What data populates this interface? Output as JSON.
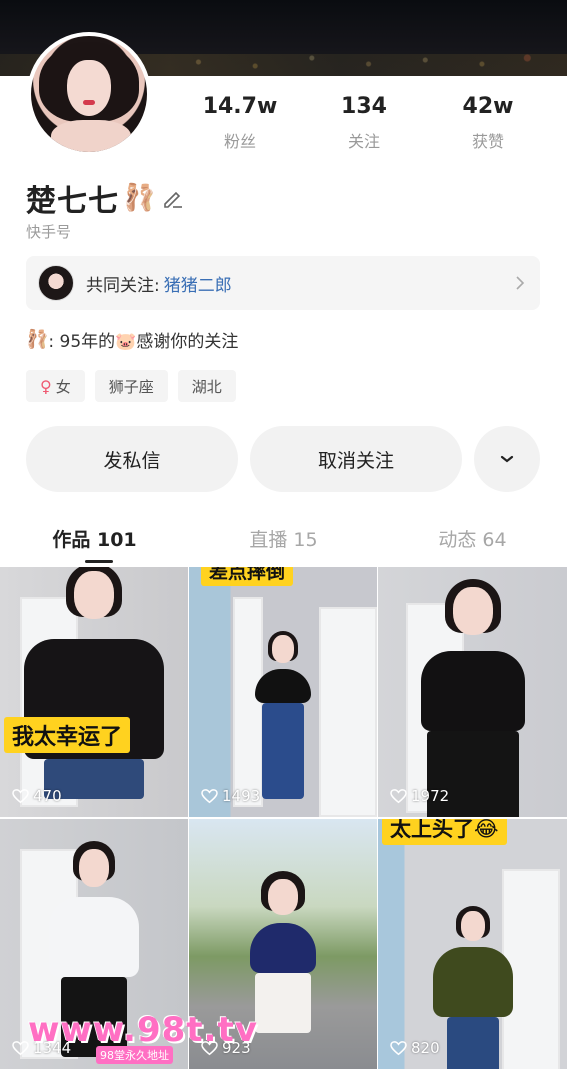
{
  "profile": {
    "name": "楚七七",
    "name_emoji": "🩰",
    "kuaishou_id_label": "快手号",
    "stats": [
      {
        "value": "14.7w",
        "label": "粉丝"
      },
      {
        "value": "134",
        "label": "关注"
      },
      {
        "value": "42w",
        "label": "获赞"
      }
    ],
    "mutual": {
      "label": "共同关注:",
      "name": "猪猪二郎"
    },
    "bio": {
      "emoji": "🩰",
      "text": ": 95年的🐷感谢你的关注"
    },
    "tags": [
      {
        "text": "女",
        "icon": "female-icon"
      },
      {
        "text": "狮子座"
      },
      {
        "text": "湖北"
      }
    ]
  },
  "actions": {
    "message_label": "发私信",
    "unfollow_label": "取消关注",
    "more_icon": "chevron-down-icon"
  },
  "tabs": [
    {
      "label": "作品 101",
      "active": true
    },
    {
      "label": "直播 15",
      "active": false
    },
    {
      "label": "动态 64",
      "active": false
    }
  ],
  "videos": [
    {
      "likes": "470",
      "caption": "我太幸运了"
    },
    {
      "likes": "1493",
      "caption": "差点摔倒"
    },
    {
      "likes": "1972",
      "caption": ""
    },
    {
      "likes": "1344",
      "caption": ""
    },
    {
      "likes": "923",
      "caption": ""
    },
    {
      "likes": "820",
      "caption": "太上头了😂"
    }
  ],
  "watermark": {
    "text": "www.98t.tv",
    "sub": "98堂永久地址"
  },
  "colors": {
    "accent_link": "#3a6fb5",
    "female": "#ef5a72",
    "caption_bg": "#ffd21f"
  }
}
